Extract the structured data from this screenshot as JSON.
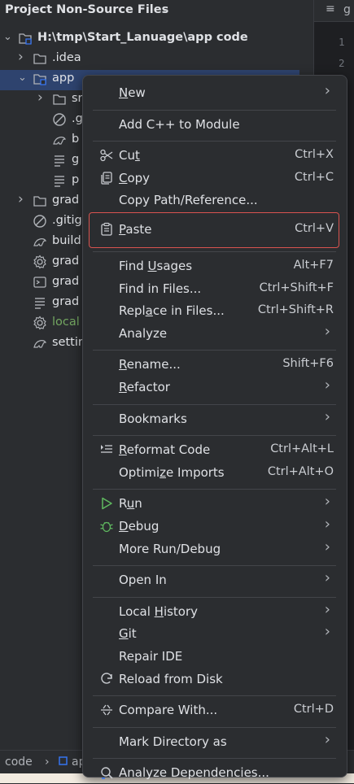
{
  "header": {
    "title": "Project Non-Source Files",
    "chevron_icon": "chevron-down-icon"
  },
  "editor": {
    "tab_label": "g",
    "line_numbers": [
      "1",
      "2"
    ]
  },
  "tree": [
    {
      "label": "H:\\tmp\\Start_Lanuage\\app code",
      "icon": "module-folder-icon",
      "arrow": "expanded",
      "indent": 0,
      "bold": true
    },
    {
      "label": ".idea",
      "icon": "folder-icon",
      "arrow": "collapsed",
      "indent": 1
    },
    {
      "label": "app",
      "icon": "module-folder-icon",
      "arrow": "expanded",
      "indent": 1,
      "selected": true
    },
    {
      "label": "sr",
      "icon": "folder-icon",
      "arrow": "collapsed",
      "indent": 2
    },
    {
      "label": ".g",
      "icon": "ignore-file-icon",
      "indent": 2
    },
    {
      "label": "b",
      "icon": "gradle-icon",
      "indent": 2
    },
    {
      "label": "g",
      "icon": "text-file-icon",
      "indent": 2
    },
    {
      "label": "p",
      "icon": "text-file-icon",
      "indent": 2
    },
    {
      "label": "grad",
      "icon": "folder-icon",
      "arrow": "collapsed",
      "indent": 1
    },
    {
      "label": ".gitig",
      "icon": "ignore-file-icon",
      "indent": 1
    },
    {
      "label": "build",
      "icon": "gradle-icon",
      "indent": 1
    },
    {
      "label": "grad",
      "icon": "settings-file-icon",
      "indent": 1
    },
    {
      "label": "grad",
      "icon": "shell-script-icon",
      "indent": 1
    },
    {
      "label": "grad",
      "icon": "text-file-icon",
      "indent": 1
    },
    {
      "label": "local",
      "icon": "settings-file-icon",
      "indent": 1,
      "green": true
    },
    {
      "label": "settin",
      "icon": "gradle-icon",
      "indent": 1
    }
  ],
  "menu": {
    "items": [
      {
        "label": "New",
        "underline": "N",
        "submenu": true
      },
      {
        "separator": true
      },
      {
        "label": "Add C++ to Module"
      },
      {
        "separator": true
      },
      {
        "label": "Cut",
        "underline_index": 2,
        "shortcut": "Ctrl+X",
        "icon": "scissors-icon"
      },
      {
        "label": "Copy",
        "underline_index": 0,
        "shortcut": "Ctrl+C",
        "icon": "copy-icon"
      },
      {
        "label": "Copy Path/Reference..."
      },
      {
        "label": "Paste",
        "underline_index": 0,
        "shortcut": "Ctrl+V",
        "icon": "clipboard-icon",
        "highlighted": true
      },
      {
        "separator": true
      },
      {
        "label": "Find Usages",
        "underline_index": 5,
        "shortcut": "Alt+F7"
      },
      {
        "label": "Find in Files...",
        "shortcut": "Ctrl+Shift+F"
      },
      {
        "label": "Replace in Files...",
        "underline_index": 4,
        "shortcut": "Ctrl+Shift+R"
      },
      {
        "label": "Analyze",
        "submenu": true
      },
      {
        "separator": true
      },
      {
        "label": "Rename...",
        "underline_index": 0,
        "shortcut": "Shift+F6"
      },
      {
        "label": "Refactor",
        "underline_index": 0,
        "submenu": true
      },
      {
        "separator": true
      },
      {
        "label": "Bookmarks",
        "submenu": true
      },
      {
        "separator": true
      },
      {
        "label": "Reformat Code",
        "underline_index": 0,
        "shortcut": "Ctrl+Alt+L",
        "icon": "reformat-icon"
      },
      {
        "label": "Optimize Imports",
        "underline_index": 6,
        "shortcut": "Ctrl+Alt+O"
      },
      {
        "separator": true
      },
      {
        "label": "Run",
        "underline_index": 1,
        "submenu": true,
        "icon": "run-icon"
      },
      {
        "label": "Debug",
        "underline_index": 0,
        "submenu": true,
        "icon": "debug-icon"
      },
      {
        "label": "More Run/Debug",
        "submenu": true
      },
      {
        "separator": true
      },
      {
        "label": "Open In",
        "submenu": true
      },
      {
        "separator": true
      },
      {
        "label": "Local History",
        "underline_index": 6,
        "submenu": true
      },
      {
        "label": "Git",
        "underline_index": 0,
        "submenu": true
      },
      {
        "label": "Repair IDE"
      },
      {
        "label": "Reload from Disk",
        "icon": "reload-icon"
      },
      {
        "separator": true
      },
      {
        "label": "Compare With...",
        "shortcut": "Ctrl+D",
        "icon": "compare-icon"
      },
      {
        "separator": true
      },
      {
        "label": "Mark Directory as",
        "submenu": true
      },
      {
        "separator": true
      },
      {
        "label": "Analyze Dependencies...",
        "icon": "analyze-deps-icon"
      }
    ]
  },
  "statusbar": {
    "crumb1": "code",
    "crumb2": "ap"
  },
  "colors": {
    "highlight_border": "#d9534f",
    "selection_bg": "#2e436e",
    "run_green": "#5fb85f"
  }
}
